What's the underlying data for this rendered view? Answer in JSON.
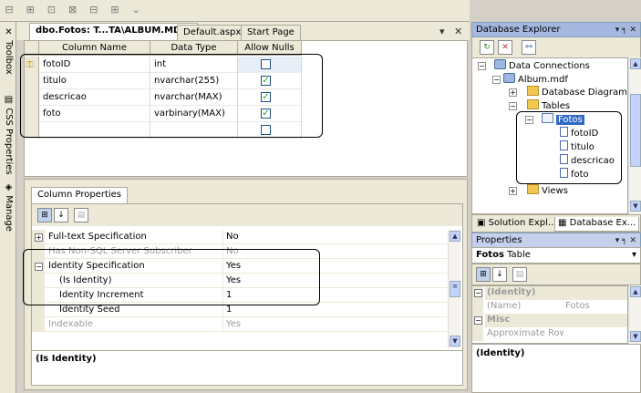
{
  "toolbar": {
    "icons": [
      "align-left-icon",
      "align-center-icon",
      "align-right-icon",
      "distribute-icon",
      "spacing-icon",
      "layout-icon",
      "overflow-icon"
    ]
  },
  "left_strip": {
    "toolbox": "Toolbox",
    "css_properties": "CSS Properties",
    "manage_styles": "Manage Styles"
  },
  "doc_tabs": [
    {
      "label": "dbo.Fotos: T...TA\\ALBUM.MDF)"
    },
    {
      "label": "Default.aspx"
    },
    {
      "label": "Start Page"
    }
  ],
  "doc_controls": {
    "dropdown": "▾",
    "close": "✕"
  },
  "grid": {
    "headers": [
      "Column Name",
      "Data Type",
      "Allow Nulls"
    ],
    "rows": [
      {
        "name": "fotoID",
        "type": "int",
        "nulls": false,
        "key": true
      },
      {
        "name": "titulo",
        "type": "nvarchar(255)",
        "nulls": true,
        "key": false
      },
      {
        "name": "descricao",
        "type": "nvarchar(MAX)",
        "nulls": true,
        "key": false
      },
      {
        "name": "foto",
        "type": "varbinary(MAX)",
        "nulls": true,
        "key": false
      },
      {
        "name": "",
        "type": "",
        "nulls": false,
        "key": false
      }
    ]
  },
  "column_props": {
    "tab": "Column Properties",
    "rows": [
      {
        "name": "Full-text Specification",
        "value": "No",
        "exp": "+",
        "grey": false
      },
      {
        "name": "Has Non-SQL Server Subscriber",
        "value": "No",
        "exp": "",
        "grey": true
      },
      {
        "name": "Identity Specification",
        "value": "Yes",
        "exp": "−",
        "grey": false
      },
      {
        "name": "(Is Identity)",
        "value": "Yes",
        "exp": "",
        "grey": false,
        "indent": true
      },
      {
        "name": "Identity Increment",
        "value": "1",
        "exp": "",
        "grey": false,
        "indent": true
      },
      {
        "name": "Identity Seed",
        "value": "1",
        "exp": "",
        "grey": false,
        "indent": true
      },
      {
        "name": "Indexable",
        "value": "Yes",
        "exp": "",
        "grey": true
      }
    ],
    "description": "(Is Identity)"
  },
  "db_explorer": {
    "title": "Database Explorer",
    "title_controls": "▾ ╕ ✕",
    "tree": {
      "data_connections": "Data Connections",
      "album": "Album.mdf",
      "diagrams": "Database Diagrams",
      "tables": "Tables",
      "fotos": "Fotos",
      "cols": [
        "fotoID",
        "titulo",
        "descricao",
        "foto"
      ],
      "views": "Views"
    },
    "tabs": [
      "Solution Expl...",
      "Database Ex..."
    ]
  },
  "properties": {
    "title": "Properties",
    "title_controls": "▾ ╕ ✕",
    "object_name": "Fotos",
    "object_type": "Table",
    "rows": [
      {
        "name": "(Identity)",
        "value": "",
        "cat": true,
        "exp": "−"
      },
      {
        "name": "(Name)",
        "value": "Fotos",
        "cat": false,
        "exp": ""
      },
      {
        "name": "Misc",
        "value": "",
        "cat": true,
        "exp": "−"
      },
      {
        "name": "Approximate Row C...",
        "value": "",
        "cat": false,
        "exp": ""
      }
    ],
    "description": "(Identity)"
  }
}
